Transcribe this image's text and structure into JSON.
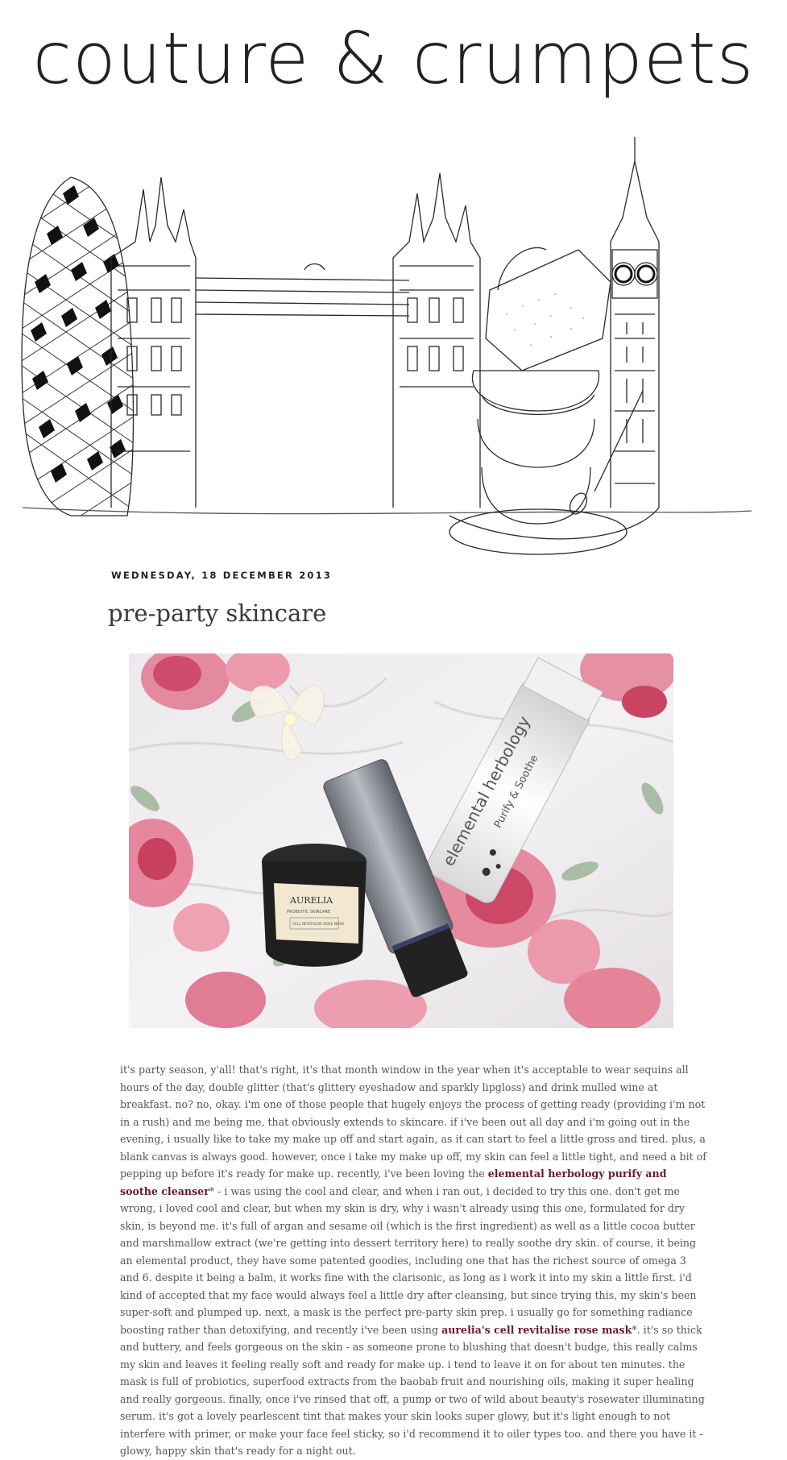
{
  "site": {
    "title": "couture & crumpets"
  },
  "post": {
    "date": "WEDNESDAY, 18 DECEMBER 2013",
    "title": "pre-party skincare",
    "photo_labels": {
      "aurelia_brand": "AURELIA",
      "aurelia_sub": "PROBIOTIC SKINCARE",
      "aurelia_product": "CELL REVITALISE ROSE MASK",
      "elemental_brand": "elemental herbology",
      "elemental_product": "Purify & Soothe"
    },
    "body": {
      "p1": "it's party season, y'all! that's right, it's that month window in the year when it's acceptable to wear sequins all hours of the day, double glitter (that's glittery eyeshadow and sparkly lipgloss) and drink mulled wine at breakfast. no? no, okay. i'm one of those people that hugely enjoys the process of getting ready (providing i'm not in a rush) and me being me, that obviously extends to skincare. if i've been out all day and i'm going out in the evening, i usually like to take my make up off and start again, as it can start to feel a little gross and tired. plus, a blank canvas is always good. however, once i take my make up off, my skin can feel a little tight, and need a bit of pepping up before it's ready for make up. recently, i've been loving the ",
      "link1": "elemental herbology purify and soothe cleanser",
      "p2": "* - i was using the cool and clear, and when i ran out, i decided to try this one. don't get me wrong, i loved cool and clear, but when my skin is dry, why i wasn't already using this one, formulated for dry skin, is beyond me. it's full of argan and sesame oil (which is the first ingredient) as well as a little cocoa butter and marshmallow extract (we're getting into dessert territory here) to really soothe dry skin. of course, it being an elemental product, they have some patented goodies, including one that has the richest source of omega 3 and 6. despite it being a balm, it works fine with the clarisonic, as long as i work it into my skin a little first. i'd kind of accepted that my face would always feel a little dry after cleansing, but since trying this, my skin's been super-soft and plumped up. next, a mask is the perfect pre-party skin prep. i usually go for something radiance boosting rather than detoxifying, and recently i've been using ",
      "link2": "aurelia's cell revitalise rose mask",
      "p3": "*. it's so thick and buttery, and feels gorgeous on the skin - as someone prone to blushing that doesn't budge, this really calms my skin and leaves it feeling really soft and ready for make up. i tend to leave it on for about ten minutes. the mask is full of probiotics, superfood extracts from the baobab fruit and nourishing oils, making it super healing and really gorgeous. finally, once i've rinsed that off, a pump or two of wild about beauty's rosewater illuminating serum. it's got a lovely pearlescent tint that makes your skin looks super glowy, but it's light enough to not interfere with primer, or make your face feel sticky, so i'd recommend it to oiler types too. and there you have it - glowy, happy skin that's ready for a night out."
    }
  }
}
